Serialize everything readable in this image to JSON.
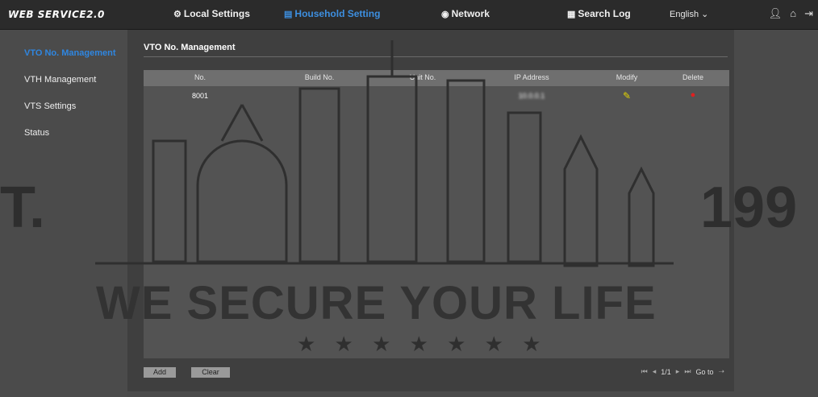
{
  "header": {
    "brand": "WEB SERVICE2.0",
    "nav": [
      {
        "label": "Local Settings",
        "icon": "gear-icon"
      },
      {
        "label": "Household Setting",
        "icon": "bars-icon"
      },
      {
        "label": "Network",
        "icon": "globe-icon"
      },
      {
        "label": "Search Log",
        "icon": "doc-icon"
      }
    ],
    "language": "English",
    "icons": [
      "user-icon",
      "home-icon",
      "logout-icon"
    ]
  },
  "sidebar": {
    "items": [
      {
        "label": "VTO No. Management"
      },
      {
        "label": "VTH Management"
      },
      {
        "label": "VTS Settings"
      },
      {
        "label": "Status"
      }
    ]
  },
  "main": {
    "tab": "VTO No. Management",
    "table": {
      "headers": [
        "No.",
        "Build No.",
        "Unit No.",
        "IP Address",
        "Modify",
        "Delete"
      ],
      "rows": [
        {
          "no": "8001",
          "build": "",
          "unit": "",
          "ip": "10.0.0.1"
        }
      ]
    },
    "buttons": {
      "add": "Add",
      "clear": "Clear"
    },
    "pager": {
      "page": "1/1",
      "goto": "Go to"
    }
  },
  "watermark": {
    "tagline": "WE SECURE YOUR LIFE",
    "left_fragment": "T.",
    "right_fragment": "199",
    "stars": "★ ★ ★ ★ ★ ★ ★"
  },
  "colors": {
    "accent": "#2f86e0",
    "modify": "#e3d400",
    "delete": "#e02020"
  }
}
